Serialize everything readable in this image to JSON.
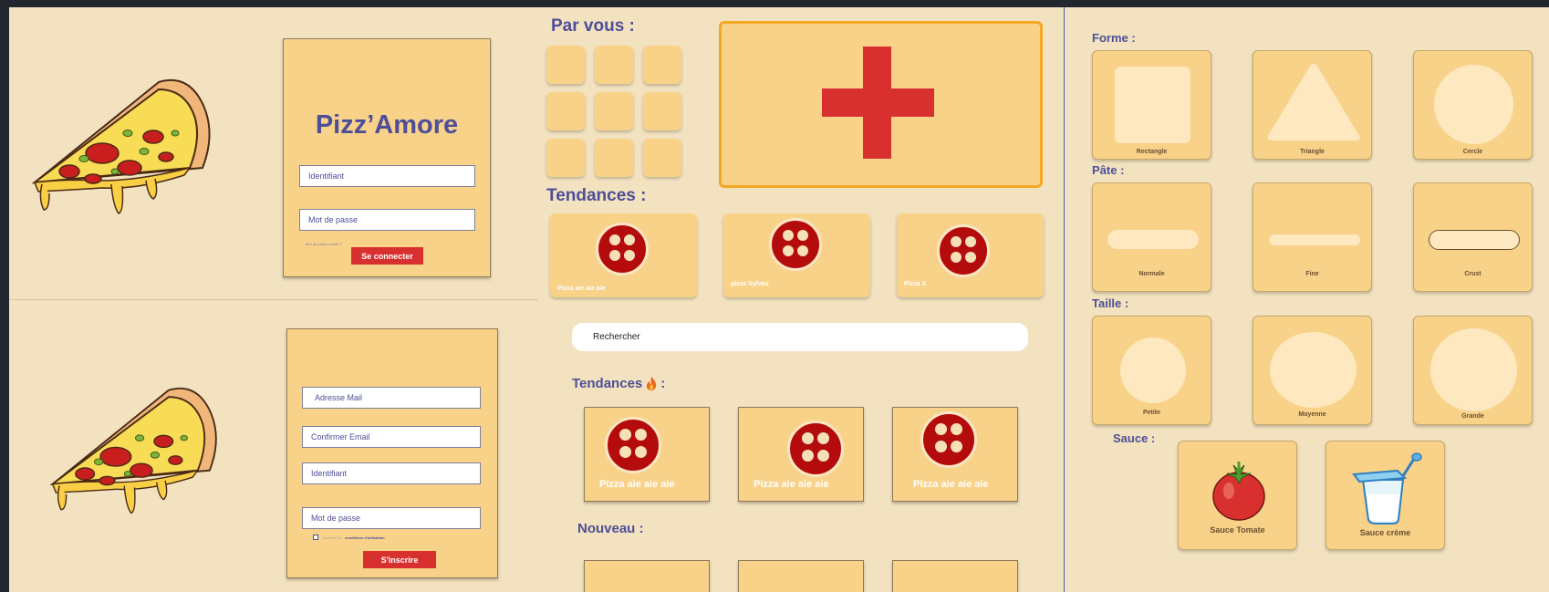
{
  "login": {
    "title": "Pizz’Amore",
    "id_placeholder": "Identifiant",
    "pwd_placeholder": "Mot de passe",
    "forgot": "Mot de passe oublié ?",
    "submit": "Se connecter"
  },
  "signup": {
    "mail_placeholder": "Adresse Mail",
    "confirm_placeholder": "Confirmer Email",
    "id_placeholder": "Identifiant",
    "pwd_placeholder": "Mot de passe",
    "accept_prefix": "J'accepte les",
    "accept_link": "conditions d'utilisation",
    "submit": "S'inscrire"
  },
  "home": {
    "par_vous": "Par vous :",
    "tendances": "Tendances :",
    "trend_items": [
      {
        "label": "Pizza aie aie aie"
      },
      {
        "label": "pizza Sylvau"
      },
      {
        "label": "Pizza X"
      }
    ]
  },
  "search": {
    "placeholder": "Rechercher",
    "tendances": "Tendances",
    "trend_items": [
      {
        "label": "Pizza aie aie aie"
      },
      {
        "label": "Pizza aie aie aie"
      },
      {
        "label": "Pizza aie aie aie"
      }
    ],
    "nouveau": "Nouveau :"
  },
  "builder": {
    "forme": "Forme :",
    "forme_options": [
      "Rectangle",
      "Triangle",
      "Cercle"
    ],
    "pate": "Pâte :",
    "pate_options": [
      "Normale",
      "Fine",
      "Crust"
    ],
    "taille": "Taille :",
    "taille_options": [
      "Petite",
      "Moyenne",
      "Grande"
    ],
    "sauce": "Sauce :",
    "sauce_options": [
      "Sauce Tomate",
      "Sauce crème"
    ]
  },
  "colors": {
    "background": "#f2e2bf",
    "card": "#f9d28a",
    "accent_red": "#d8302f",
    "heading": "#4e4f98",
    "plus_border": "#f4a824"
  },
  "icons": [
    "pizza-slice-icon",
    "pepperoni-icon",
    "plus-icon",
    "fire-icon",
    "tomato-icon",
    "cream-cup-icon"
  ]
}
